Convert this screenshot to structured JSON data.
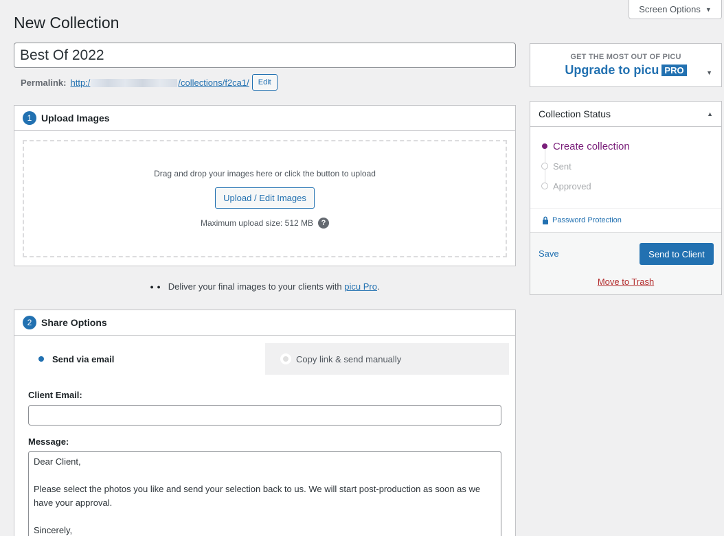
{
  "screen_options": {
    "label": "Screen Options"
  },
  "page": {
    "title": "New Collection"
  },
  "collection": {
    "title_value": "Best Of 2022",
    "permalink_label": "Permalink:",
    "permalink_prefix": "http:/",
    "permalink_suffix": "/collections/f2ca1/",
    "edit_label": "Edit"
  },
  "upload": {
    "step": "1",
    "heading": "Upload Images",
    "drop_text": "Drag and drop your images here or click the button to upload",
    "button_label": "Upload / Edit Images",
    "max_size": "Maximum upload size: 512 MB",
    "help_glyph": "?"
  },
  "pro_note": {
    "eyes": "● ●",
    "text": "Deliver your final images to your clients with",
    "link": "picu Pro",
    "suffix": "."
  },
  "share": {
    "step": "2",
    "heading": "Share Options",
    "tabs": [
      {
        "label": "Send via email",
        "active": true
      },
      {
        "label": "Copy link & send manually",
        "active": false
      }
    ],
    "email_label": "Client Email:",
    "email_value": "",
    "message_label": "Message:",
    "message_value": "Dear Client,\n\nPlease select the photos you like and send your selection back to us. We will start post-production as soon as we have your approval.\n\nSincerely,"
  },
  "upgrade": {
    "small": "GET THE MOST OUT OF PICU",
    "big": "Upgrade to picu",
    "badge": "PRO"
  },
  "status": {
    "heading": "Collection Status",
    "steps": [
      {
        "label": "Create collection",
        "current": true
      },
      {
        "label": "Sent",
        "current": false
      },
      {
        "label": "Approved",
        "current": false
      }
    ],
    "password_link": "Password Protection",
    "save_label": "Save",
    "send_label": "Send to Client",
    "trash_label": "Move to Trash"
  },
  "colors": {
    "accent": "#2271b1",
    "status_current": "#7a1f7a",
    "danger": "#b32d2e"
  }
}
